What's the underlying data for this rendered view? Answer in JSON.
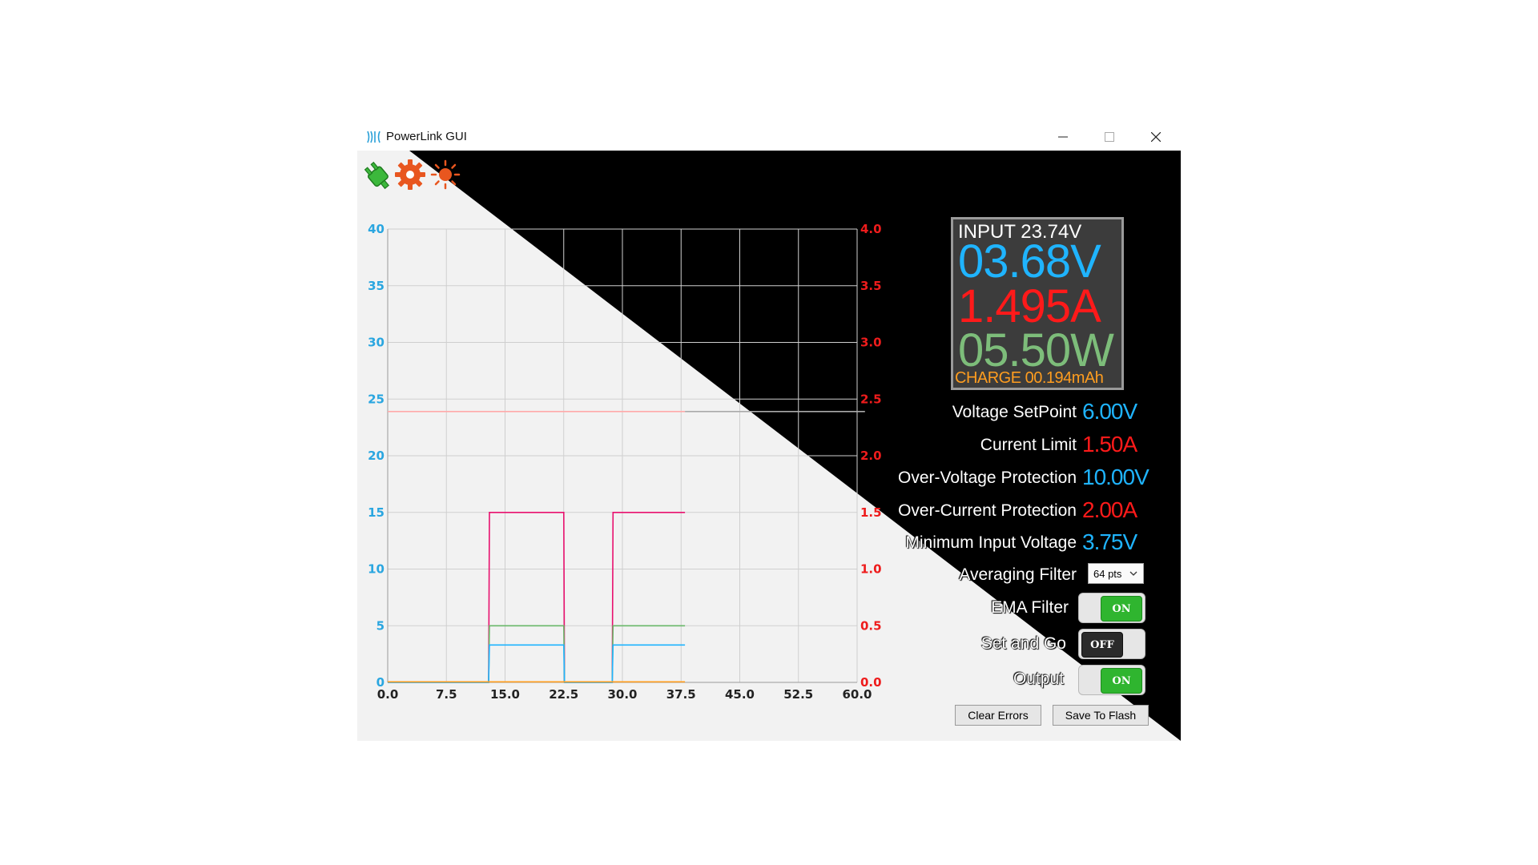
{
  "window": {
    "title": "PowerLink GUI"
  },
  "display": {
    "input": "INPUT 23.74V",
    "voltage": "03.68V",
    "current": "1.495A",
    "power": "05.50W",
    "charge": "CHARGE 00.194mAh"
  },
  "params": {
    "voltage_setpoint": {
      "label": "Voltage SetPoint",
      "value": "6.00V"
    },
    "current_limit": {
      "label": "Current Limit",
      "value": "1.50A"
    },
    "ovp": {
      "label": "Over-Voltage Protection",
      "value": "10.00V"
    },
    "ocp": {
      "label": "Over-Current Protection",
      "value": "2.00A"
    },
    "min_input": {
      "label": "Minimum Input Voltage",
      "value": "3.75V"
    }
  },
  "averaging_filter": {
    "label": "Averaging Filter",
    "value": "64 pts"
  },
  "toggles": {
    "ema": {
      "label": "EMA Filter",
      "state": "ON"
    },
    "set_and_go": {
      "label": "Set and Go",
      "state": "OFF"
    },
    "output": {
      "label": "Output",
      "state": "ON"
    }
  },
  "buttons": {
    "clear_errors": "Clear Errors",
    "save_to_flash": "Save To Flash"
  },
  "icons": [
    "usb-plug-icon",
    "settings-gear-icon",
    "brightness-icon"
  ],
  "colors": {
    "voltage": "#1fb4ff",
    "current": "#ff1a1a",
    "power": "#7dbd7a",
    "charge": "#ff9d1f"
  },
  "chart_data": {
    "type": "line",
    "xlim": [
      0,
      60
    ],
    "ylim_left": [
      0,
      40
    ],
    "ylim_right": [
      0,
      4
    ],
    "x_ticks": [
      "0.0",
      "7.5",
      "15.0",
      "22.5",
      "30.0",
      "37.5",
      "45.0",
      "52.5",
      "60.0"
    ],
    "y_left_ticks": [
      "0",
      "5",
      "10",
      "15",
      "20",
      "25",
      "30",
      "35",
      "40"
    ],
    "y_right_ticks": [
      "0.0",
      "0.5",
      "1.0",
      "1.5",
      "2.0",
      "2.5",
      "3.0",
      "3.5",
      "4.0"
    ],
    "grid": true,
    "series": [
      {
        "axis": "left",
        "color": "#ffaaaa",
        "x": [
          0,
          38
        ],
        "y": [
          23.9,
          23.9
        ]
      },
      {
        "axis": "left",
        "color": "#aaaaaa",
        "x": [
          38,
          61
        ],
        "y": [
          23.9,
          23.9
        ]
      },
      {
        "axis": "right",
        "color": "#e8106e",
        "x": [
          0,
          12.9,
          13.0,
          13.1,
          22.5,
          22.6,
          28.7,
          28.8,
          38
        ],
        "y": [
          0,
          0,
          1.5,
          1.5,
          1.5,
          0,
          0,
          1.5,
          1.5
        ]
      },
      {
        "axis": "left",
        "color": "#6ab86a",
        "x": [
          0,
          12.9,
          13.0,
          22.5,
          22.6,
          28.7,
          28.8,
          38
        ],
        "y": [
          0,
          0,
          5.0,
          5.0,
          0,
          0,
          5.0,
          5.0
        ]
      },
      {
        "axis": "left",
        "color": "#1fb4ff",
        "x": [
          0,
          12.9,
          13.0,
          22.5,
          22.6,
          28.7,
          28.8,
          38
        ],
        "y": [
          0,
          0,
          3.3,
          3.3,
          0,
          0,
          3.3,
          3.3
        ]
      },
      {
        "axis": "left",
        "color": "#ff9d1f",
        "x": [
          0,
          38
        ],
        "y": [
          0.05,
          0.05
        ]
      }
    ]
  }
}
